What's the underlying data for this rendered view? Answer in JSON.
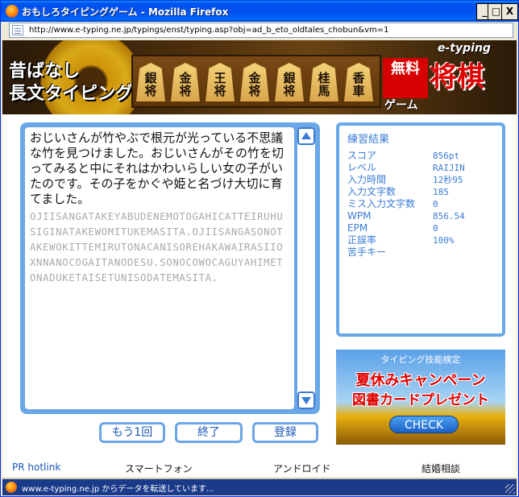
{
  "window": {
    "title": "おもしろタイピングゲーム - Mozilla Firefox",
    "minimize_label": "_",
    "maximize_label": "□",
    "close_label": "X"
  },
  "address_bar": {
    "url": "http://www.e-typing.ne.jp/typings/enst/typing.asp?obj=ad_b_eto_oldtales_chobun&vm=1"
  },
  "banner": {
    "title_line1": "昔ばなし",
    "title_line2": "長文タイピング",
    "brand": "e-typing",
    "pieces": [
      {
        "line1": "銀",
        "line2": "将"
      },
      {
        "line1": "金",
        "line2": "将"
      },
      {
        "line1": "王",
        "line2": "将"
      },
      {
        "line1": "金",
        "line2": "将"
      },
      {
        "line1": "銀",
        "line2": "将"
      },
      {
        "line1": "桂",
        "line2": "馬"
      },
      {
        "line1": "香",
        "line2": "車"
      }
    ],
    "free_badge": "無料",
    "game_label": "ゲーム",
    "shogi_label": "将棋",
    "info_icon": "i"
  },
  "typing": {
    "target_text": "おじいさんが竹やぶで根元が光っている不思議な竹を見つけました。おじいさんがその竹を切ってみると中にそれはかわいらしい女の子がいたのです。その子をかぐや姫と名づけ大切に育てました。",
    "romaji_text": "OJIISANGATAKEYABUDENEMOTOGAHICATTEIRUHUSIGINATAKEWOMITUKEMASITA.OJIISANGASONOTAKEWOKITTEMIRUTONACANISOREHAKAWAIRASIIOXNNANOCOGAITANODESU.SONOCOWOCAGUYAHIMETONADUKETAISETUNISODATEMASITA."
  },
  "buttons": {
    "retry": "もう1回",
    "finish": "終了",
    "register": "登録"
  },
  "results": {
    "title": "練習結果",
    "rows": [
      {
        "label": "スコア",
        "value": "856pt"
      },
      {
        "label": "レベル",
        "value": "RAIJIN"
      },
      {
        "label": "入力時間",
        "value": "12秒95"
      },
      {
        "label": "入力文字数",
        "value": "185"
      },
      {
        "label": "ミス入力文字数",
        "value": "0"
      },
      {
        "label": "WPM",
        "value": "856.54"
      },
      {
        "label": "EPM",
        "value": "0"
      },
      {
        "label": "正誤率",
        "value": "100%"
      },
      {
        "label": "苦手キー",
        "value": ""
      }
    ]
  },
  "ad": {
    "header": "タイピング技能検定",
    "line1": "夏休みキャンペーン",
    "line2": "図書カードプレゼント",
    "button": "CHECK"
  },
  "footer": {
    "pr": "PR hotlink",
    "smartphone": "スマートフォン",
    "android": "アンドロイド",
    "marriage": "結婚相談"
  },
  "status": {
    "text": "www.e-typing.ne.jp からデータを転送しています..."
  },
  "colors": {
    "accent": "#3a7bd5",
    "panel_border": "#68a8e8",
    "titlebar": "#0053ee"
  }
}
